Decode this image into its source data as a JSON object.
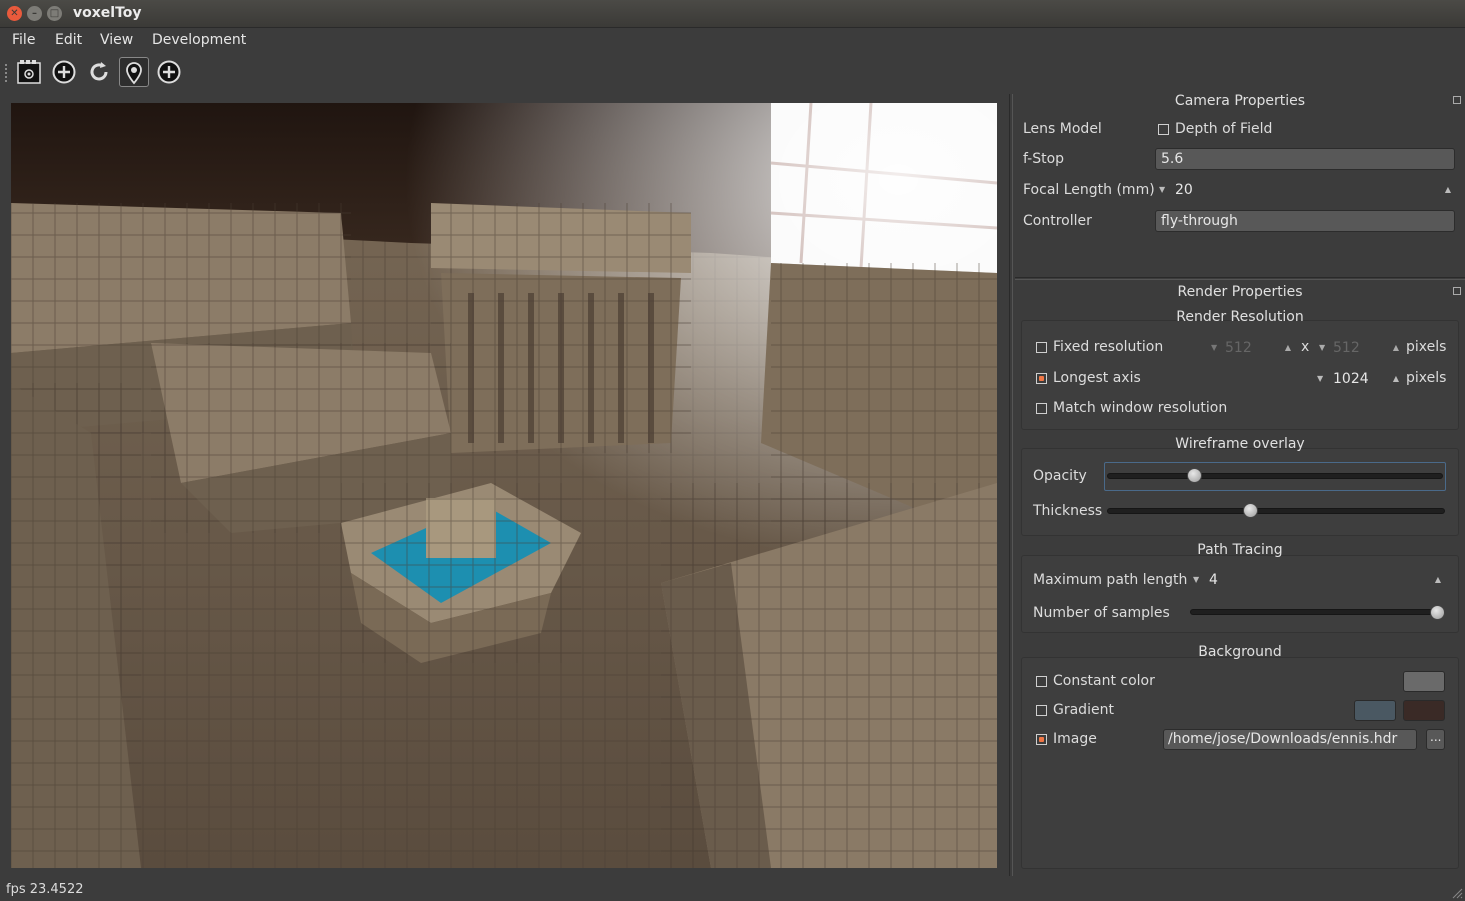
{
  "window": {
    "title": "voxelToy"
  },
  "menu": {
    "items": [
      "File",
      "Edit",
      "View",
      "Development"
    ]
  },
  "camera_panel": {
    "title": "Camera Properties",
    "lens_model_label": "Lens Model",
    "depth_of_field_label": "Depth of Field",
    "depth_of_field_checked": false,
    "fstop_label": "f-Stop",
    "fstop_value": "5.6",
    "focal_length_label": "Focal Length (mm)",
    "focal_length_value": "20",
    "controller_label": "Controller",
    "controller_value": "fly-through"
  },
  "render_panel": {
    "title": "Render Properties",
    "resolution_group": "Render Resolution",
    "fixed_resolution_label": "Fixed resolution",
    "fixed_resolution_checked": false,
    "fixed_width": "512",
    "fixed_x": "x",
    "fixed_height": "512",
    "pixels_label": "pixels",
    "longest_axis_label": "Longest axis",
    "longest_axis_checked": true,
    "longest_axis_value": "1024",
    "match_window_label": "Match window resolution",
    "match_window_checked": false,
    "wireframe_group": "Wireframe overlay",
    "opacity_label": "Opacity",
    "opacity_value": 0.25,
    "thickness_label": "Thickness",
    "thickness_value": 0.42,
    "path_tracing_group": "Path Tracing",
    "max_path_label": "Maximum path length",
    "max_path_value": "4",
    "num_samples_label": "Number of samples",
    "num_samples_value": 1.0,
    "background_group": "Background",
    "constant_color_label": "Constant color",
    "constant_color_checked": false,
    "constant_color": "#6a6a6a",
    "gradient_label": "Gradient",
    "gradient_checked": false,
    "gradient_color_1": "#4a5862",
    "gradient_color_2": "#3a2a26",
    "image_label": "Image",
    "image_checked": true,
    "image_path": "/home/jose/Downloads/ennis.hdr",
    "browse_label": "..."
  },
  "toolbar": {
    "icons": [
      "render-camera-icon",
      "add-circle-icon",
      "refresh-icon",
      "location-pin-icon",
      "add-circle-icon"
    ]
  },
  "status": {
    "fps_text": "fps 23.4522"
  },
  "colors": {
    "accent": "#f07746",
    "window_close": "#e95a3c",
    "water": "#1d8fb0"
  }
}
